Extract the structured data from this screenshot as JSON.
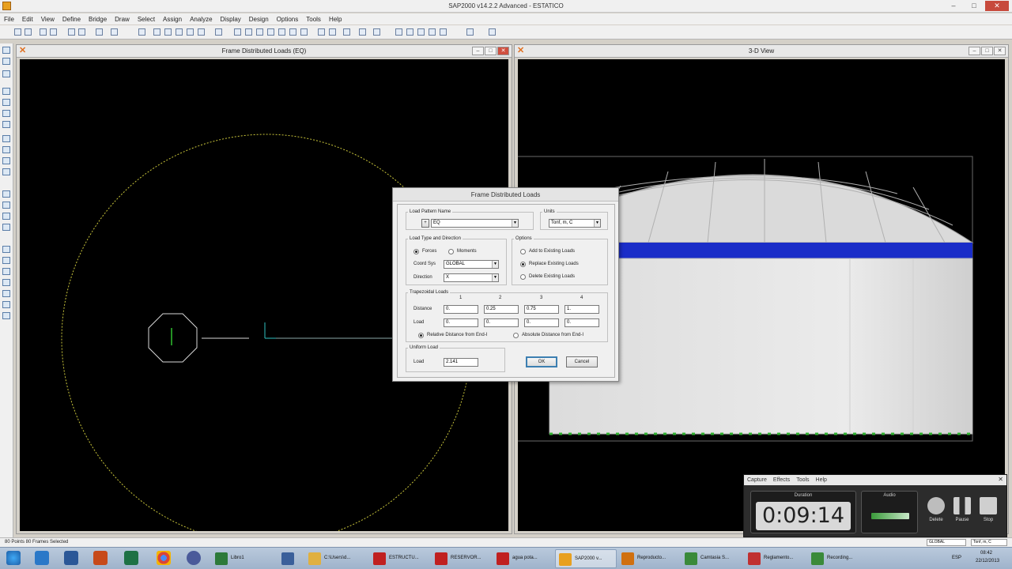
{
  "window": {
    "title": "SAP2000 v14.2.2 Advanced  -  ESTATICO",
    "controls": [
      "–",
      "□",
      "✕"
    ]
  },
  "menu": [
    "File",
    "Edit",
    "View",
    "Define",
    "Bridge",
    "Draw",
    "Select",
    "Assign",
    "Analyze",
    "Display",
    "Design",
    "Options",
    "Tools",
    "Help"
  ],
  "left_window": {
    "title": "Frame Distributed Loads (EQ)"
  },
  "right_window": {
    "title": "3-D View"
  },
  "dialog": {
    "title": "Frame Distributed Loads",
    "load_pattern": {
      "legend": "Load Pattern Name",
      "value": "EQ"
    },
    "units": {
      "legend": "Units",
      "value": "Tonf, m, C"
    },
    "load_type": {
      "legend": "Load Type and Direction",
      "forces": "Forces",
      "moments": "Moments",
      "coord_sys_label": "Coord Sys",
      "coord_sys_value": "GLOBAL",
      "direction_label": "Direction",
      "direction_value": "X"
    },
    "options": {
      "legend": "Options",
      "add": "Add to Existing Loads",
      "replace": "Replace Existing Loads",
      "delete": "Delete Existing Loads"
    },
    "trapezoidal": {
      "legend": "Trapezoidal Loads",
      "columns": [
        "1",
        "2",
        "3",
        "4"
      ],
      "distance_label": "Distance",
      "load_label": "Load",
      "distances": [
        "0.",
        "0.25",
        "0.75",
        "1."
      ],
      "loads": [
        "0.",
        "0.",
        "0.",
        "0."
      ],
      "relative": "Relative Distance from End-I",
      "absolute": "Absolute Distance from End-I"
    },
    "uniform": {
      "legend": "Uniform Load",
      "load_label": "Load",
      "value": "2.141"
    },
    "ok": "OK",
    "cancel": "Cancel"
  },
  "capture": {
    "menu": [
      "Capture",
      "Effects",
      "Tools",
      "Help"
    ],
    "close": "✕",
    "duration_label": "Duration",
    "duration": "0:09:14",
    "audio_label": "Audio",
    "delete": "Delete",
    "pause": "Pause",
    "stop": "Stop"
  },
  "status": {
    "text": "80 Points  80 Frames Selected",
    "coord": "GLOBAL",
    "units": "Tonf, m, C"
  },
  "taskbar": {
    "items": [
      {
        "label": "Libro1",
        "color": "#2d7a3a"
      },
      {
        "label": "",
        "color": "#3a5f9a"
      },
      {
        "label": "C:\\Users\\d...",
        "color": "#e0b040"
      },
      {
        "label": "ESTRUCTU...",
        "color": "#c02020"
      },
      {
        "label": "RESERVOR...",
        "color": "#c02020"
      },
      {
        "label": "agua pota...",
        "color": "#c02020"
      },
      {
        "label": "SAP2000 v...",
        "color": "#e8a020"
      },
      {
        "label": "Reproducto...",
        "color": "#d07010"
      },
      {
        "label": "Camtasia S...",
        "color": "#3a8a3a"
      },
      {
        "label": "Reglamento...",
        "color": "#c03030"
      },
      {
        "label": "Recording...",
        "color": "#3a8a3a"
      }
    ],
    "lang": "ESP",
    "time": "08:42",
    "date": "22/12/2013"
  }
}
